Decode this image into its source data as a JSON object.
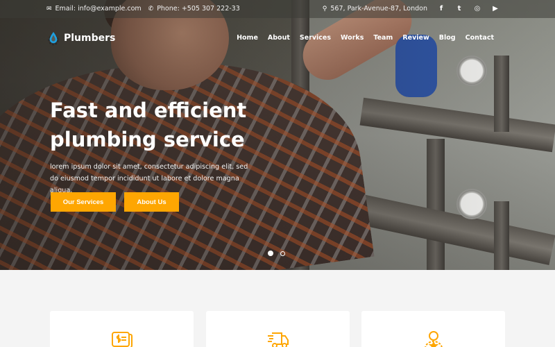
{
  "topbar": {
    "email_label": "Email: info@example.com",
    "phone_label": "Phone: +505 307 222-33",
    "address_label": "567, Park-Avenue-87, London",
    "social": [
      {
        "name": "facebook",
        "glyph": "f"
      },
      {
        "name": "twitter",
        "glyph": "t"
      },
      {
        "name": "instagram",
        "glyph": "◎"
      },
      {
        "name": "youtube",
        "glyph": "▶"
      }
    ]
  },
  "brand": {
    "name": "Plumbers",
    "colors": {
      "accent": "#fea602",
      "logo_drop": "#1ea0e0"
    }
  },
  "nav": {
    "items": [
      "Home",
      "About",
      "Services",
      "Works",
      "Team",
      "Review",
      "Blog",
      "Contact"
    ]
  },
  "hero": {
    "title_line1": "Fast and efficient",
    "title_line2": "plumbing service",
    "subtitle": "lorem ipsum dolor sit amet, consectetur adipiscing elit, sed do eiusmod tempor incididunt ut labore et dolore magna aliqua.",
    "buttons": {
      "primary": "Our Services",
      "secondary": "About Us"
    },
    "slider": {
      "total": 2,
      "active": 1
    }
  },
  "services": {
    "cards": [
      {
        "icon": "invoice-dollar-icon"
      },
      {
        "icon": "delivery-truck-icon"
      },
      {
        "icon": "user-star-icon"
      }
    ]
  }
}
